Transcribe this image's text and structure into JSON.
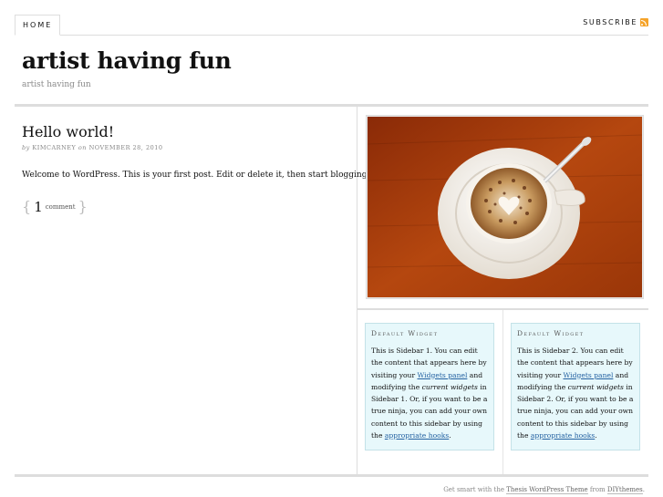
{
  "nav": {
    "home_label": "HOME",
    "subscribe_label": "SUBSCRIBE",
    "subscribe_icon": "rss-icon"
  },
  "header": {
    "title": "artist having fun",
    "tagline": "artist having fun"
  },
  "post": {
    "title": "Hello world!",
    "by_prefix": "by",
    "author": "KIMCARNEY",
    "on_word": "on",
    "date": "NOVEMBER 28, 2010",
    "body": "Welcome to WordPress. This is your first post. Edit or delete it, then start blogging!",
    "comment_count": "1",
    "comment_label": "comment",
    "brace_open": "{",
    "brace_close": "}"
  },
  "sidebar1": {
    "title": "Default Widget",
    "text_a": "This is Sidebar 1. You can edit the content that appears here by visiting your ",
    "link_widgets": "Widgets panel",
    "text_b": " and modifying the ",
    "current_widgets": "current widgets",
    "text_c": " in Sidebar 1. Or, if you want to be a true ninja, you can add your own content to this sidebar by using the ",
    "link_hooks": "appropriate hooks",
    "text_d": "."
  },
  "sidebar2": {
    "title": "Default Widget",
    "text_a": "This is Sidebar 2. You can edit the content that appears here by visiting your ",
    "link_widgets": "Widgets panel",
    "text_b": " and modifying the ",
    "current_widgets": "current widgets",
    "text_c": " in Sidebar 2. Or, if you want to be a true ninja, you can add your own content to this sidebar by using the ",
    "link_hooks": "appropriate hooks",
    "text_d": "."
  },
  "footer": {
    "prefix": "Get smart with the ",
    "link_thesis": "Thesis WordPress Theme",
    "middle": " from ",
    "link_diy": "DIYthemes",
    "suffix": "."
  },
  "colors": {
    "link": "#2361a1",
    "widget_bg": "#e7f8fb",
    "rss": "#f5a32a"
  }
}
